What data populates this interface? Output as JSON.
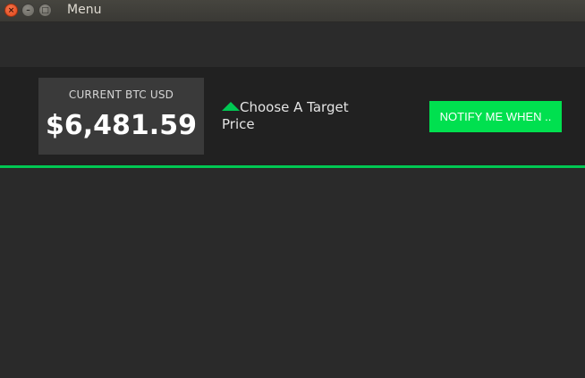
{
  "window": {
    "title": "Menu",
    "close_glyph": "×",
    "minimize_glyph": "–",
    "maximize_glyph": "□"
  },
  "price": {
    "label": "CURRENT BTC USD",
    "value": "$6,481.59"
  },
  "target": {
    "icon": "up-triangle-icon",
    "text": "Choose A Target Price"
  },
  "notify_button": {
    "label": "NOTIFY ME WHEN .."
  },
  "colors": {
    "accent": "#00c853",
    "button": "#00e04f",
    "background": "#2a2a2a",
    "panel": "#212121",
    "price_box": "#3a3a3a"
  }
}
